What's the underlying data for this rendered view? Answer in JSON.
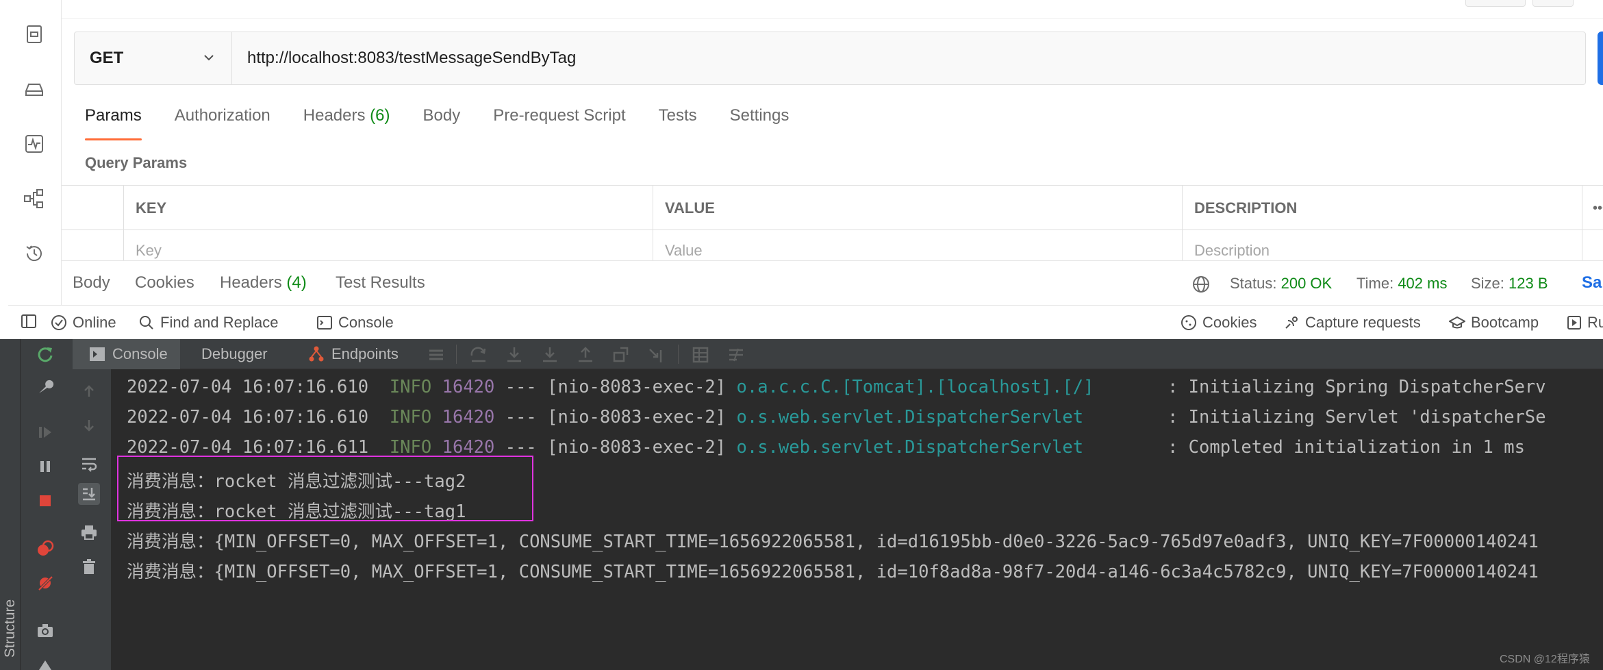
{
  "request": {
    "method": "GET",
    "url": "http://localhost:8083/testMessageSendByTag",
    "tabs": [
      {
        "label": "Params",
        "count": "",
        "active": true
      },
      {
        "label": "Authorization",
        "count": ""
      },
      {
        "label": "Headers",
        "count": "(6)"
      },
      {
        "label": "Body",
        "count": ""
      },
      {
        "label": "Pre-request Script",
        "count": ""
      },
      {
        "label": "Tests",
        "count": ""
      },
      {
        "label": "Settings",
        "count": ""
      }
    ],
    "query_params_title": "Query Params",
    "table": {
      "headers": [
        "KEY",
        "VALUE",
        "DESCRIPTION"
      ],
      "placeholders": [
        "Key",
        "Value",
        "Description"
      ]
    }
  },
  "response": {
    "tabs": [
      {
        "label": "Body",
        "count": ""
      },
      {
        "label": "Cookies",
        "count": ""
      },
      {
        "label": "Headers",
        "count": "(4)"
      },
      {
        "label": "Test Results",
        "count": ""
      }
    ],
    "status_label": "Status:",
    "status_value": "200 OK",
    "time_label": "Time:",
    "time_value": "402 ms",
    "size_label": "Size:",
    "size_value": "123 B",
    "save_label": "Sa"
  },
  "statusbar": {
    "online": "Online",
    "find_replace": "Find and Replace",
    "console": "Console",
    "cookies": "Cookies",
    "capture": "Capture requests",
    "bootcamp": "Bootcamp",
    "runner": "Ru"
  },
  "ide": {
    "tabs": [
      "Console",
      "Debugger",
      "Endpoints"
    ],
    "structure_label": "Structure",
    "console_lines": [
      {
        "ts": "2022-07-04 16:07:16.610",
        "level": "INFO",
        "pid": "16420",
        "sep": " --- [nio-8083-exec-2] ",
        "logger": "o.a.c.c.C.[Tomcat].[localhost].[/]",
        "pad": "       ",
        "msg": ": Initializing Spring DispatcherServ"
      },
      {
        "ts": "2022-07-04 16:07:16.610",
        "level": "INFO",
        "pid": "16420",
        "sep": " --- [nio-8083-exec-2] ",
        "logger": "o.s.web.servlet.DispatcherServlet",
        "pad": "        ",
        "msg": ": Initializing Servlet 'dispatcherSe"
      },
      {
        "ts": "2022-07-04 16:07:16.611",
        "level": "INFO",
        "pid": "16420",
        "sep": " --- [nio-8083-exec-2] ",
        "logger": "o.s.web.servlet.DispatcherServlet",
        "pad": "        ",
        "msg": ": Completed initialization in 1 ms"
      }
    ],
    "plain_lines": [
      "消费消息：rocket 消息过滤测试---tag2",
      "消费消息：rocket 消息过滤测试---tag1",
      "消费消息：{MIN_OFFSET=0, MAX_OFFSET=1, CONSUME_START_TIME=1656922065581, id=d16195bb-d0e0-3226-5ac9-765d97e0adf3, UNIQ_KEY=7F00000140241",
      "消费消息：{MIN_OFFSET=0, MAX_OFFSET=1, CONSUME_START_TIME=1656922065581, id=10f8ad8a-98f7-20d4-a146-6c3a4c5782c9, UNIQ_KEY=7F00000140241"
    ]
  },
  "watermark": "CSDN @12程序猿",
  "colors": {
    "postman_orange": "#ff6c37",
    "status_green": "#0e8a16",
    "highlight_magenta": "#e033e0",
    "log_info_green": "#6a8759",
    "log_pid_purple": "#9876aa",
    "log_logger_teal": "#299999"
  },
  "icons": {
    "rail": [
      "collections-icon",
      "environments-icon",
      "monitors-icon",
      "flows-icon",
      "history-icon"
    ],
    "ide_left": [
      "rerun-icon",
      "wrench-icon",
      "resume-icon",
      "pause-icon",
      "stop-icon",
      "breakpoints-icon",
      "mute-breakpoints-icon",
      "camera-icon"
    ],
    "ide_inner": [
      "scroll-up-icon",
      "scroll-down-icon",
      "soft-wrap-icon",
      "scroll-to-end-icon",
      "print-icon",
      "trash-icon"
    ]
  }
}
